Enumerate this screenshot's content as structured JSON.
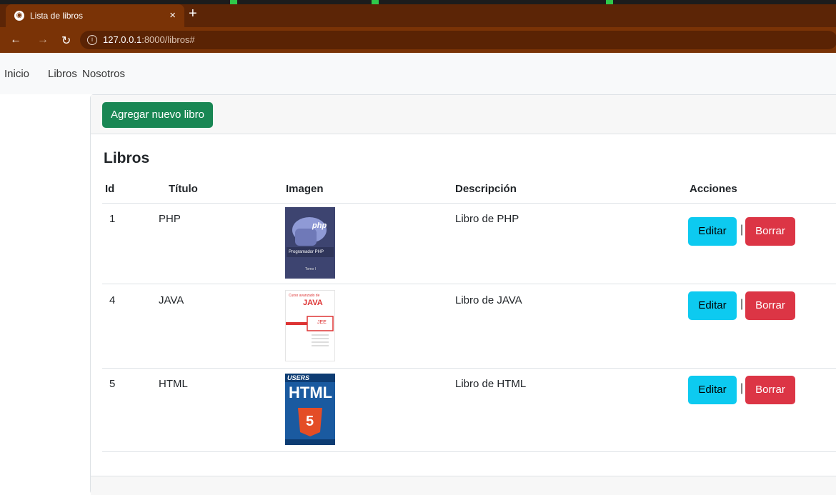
{
  "browser": {
    "tab_title": "Lista de libros",
    "url_host": "127.0.0.1",
    "url_path": ":8000/libros#"
  },
  "nav": {
    "links": [
      "Inicio",
      "Libros",
      "Nosotros"
    ]
  },
  "card": {
    "add_button": "Agregar nuevo libro",
    "title": "Libros",
    "headers": [
      "Id",
      "Título",
      "Imagen",
      "Descripción",
      "Acciones"
    ],
    "rows": [
      {
        "id": "1",
        "titulo": "PHP",
        "descripcion": "Libro de PHP",
        "cover": {
          "brand": "php",
          "line1": "Programador PHP",
          "line2": "Tomo I"
        }
      },
      {
        "id": "4",
        "titulo": "JAVA",
        "descripcion": "Libro de JAVA",
        "cover": {
          "line1": "Curso avanzado de",
          "brand": "JAVA",
          "line2": "JEE"
        }
      },
      {
        "id": "5",
        "titulo": "HTML",
        "descripcion": "Libro de HTML",
        "cover": {
          "brand": "USERS",
          "line1": "HTML",
          "line2": "5"
        }
      }
    ],
    "edit_label": "Editar",
    "delete_label": "Borrar",
    "separator": "|"
  },
  "colors": {
    "add_button": "#198754",
    "edit_button": "#0dcaf0",
    "delete_button": "#dc3545",
    "browser_chrome": "#7a3306"
  }
}
